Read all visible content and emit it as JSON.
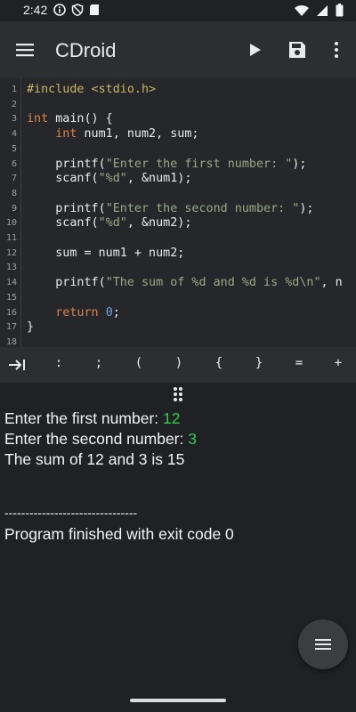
{
  "status_bar": {
    "time": "2:42",
    "left_icons": [
      "info-icon",
      "shield-icon",
      "sd-card-icon"
    ],
    "right_icons": [
      "wifi-icon",
      "signal-icon",
      "battery-icon"
    ]
  },
  "app_bar": {
    "title": "CDroid",
    "actions": [
      "menu-icon",
      "play-icon",
      "save-icon",
      "more-vert-icon"
    ]
  },
  "editor": {
    "line_numbers": [
      "1",
      "2",
      "3",
      "4",
      "5",
      "6",
      "7",
      "8",
      "9",
      "10",
      "11",
      "12",
      "13",
      "14",
      "15",
      "16",
      "17",
      "18"
    ],
    "lines": [
      [
        {
          "t": "#include <stdio.h>",
          "c": "pp"
        }
      ],
      [],
      [
        {
          "t": "int",
          "c": "kw"
        },
        {
          "t": " main() {",
          "c": ""
        }
      ],
      [
        {
          "t": "    ",
          "c": ""
        },
        {
          "t": "int",
          "c": "kw"
        },
        {
          "t": " num1, num2, sum;",
          "c": ""
        }
      ],
      [],
      [
        {
          "t": "    printf(",
          "c": ""
        },
        {
          "t": "\"Enter the first number: \"",
          "c": "str"
        },
        {
          "t": ");",
          "c": ""
        }
      ],
      [
        {
          "t": "    scanf(",
          "c": ""
        },
        {
          "t": "\"%d\"",
          "c": "str"
        },
        {
          "t": ", &num1);",
          "c": ""
        }
      ],
      [],
      [
        {
          "t": "    printf(",
          "c": ""
        },
        {
          "t": "\"Enter the second number: \"",
          "c": "str"
        },
        {
          "t": ");",
          "c": ""
        }
      ],
      [
        {
          "t": "    scanf(",
          "c": ""
        },
        {
          "t": "\"%d\"",
          "c": "str"
        },
        {
          "t": ", &num2);",
          "c": ""
        }
      ],
      [],
      [
        {
          "t": "    sum = num1 + num2;",
          "c": ""
        }
      ],
      [],
      [
        {
          "t": "    printf(",
          "c": ""
        },
        {
          "t": "\"The sum of %d and %d is %d\\n\"",
          "c": "str"
        },
        {
          "t": ", n",
          "c": ""
        }
      ],
      [],
      [
        {
          "t": "    ",
          "c": ""
        },
        {
          "t": "return",
          "c": "kw"
        },
        {
          "t": " ",
          "c": ""
        },
        {
          "t": "0",
          "c": "num"
        },
        {
          "t": ";",
          "c": ""
        }
      ],
      [
        {
          "t": "}",
          "c": ""
        }
      ],
      []
    ]
  },
  "symbol_bar": {
    "tab_icon": "tab-key-icon",
    "symbols": [
      ":",
      ";",
      "(",
      ")",
      "{",
      "}",
      "=",
      "+"
    ]
  },
  "console": {
    "prompt1": "Enter the first number: ",
    "input1": "12",
    "prompt2": "Enter the second number: ",
    "input2": "3",
    "result": "The sum of 12 and 3 is 15",
    "separator": "--------------------------------",
    "exit_message": "Program finished with exit code 0"
  },
  "fab": {
    "icon": "hamburger-menu-icon"
  },
  "colors": {
    "background": "#202124",
    "app_bar": "#2d2e31",
    "editor": "#26272a",
    "keyword": "#d9834a",
    "string": "#9aa986",
    "number": "#6aa3e8",
    "preprocessor": "#c8b464",
    "console_input": "#34c94d"
  }
}
